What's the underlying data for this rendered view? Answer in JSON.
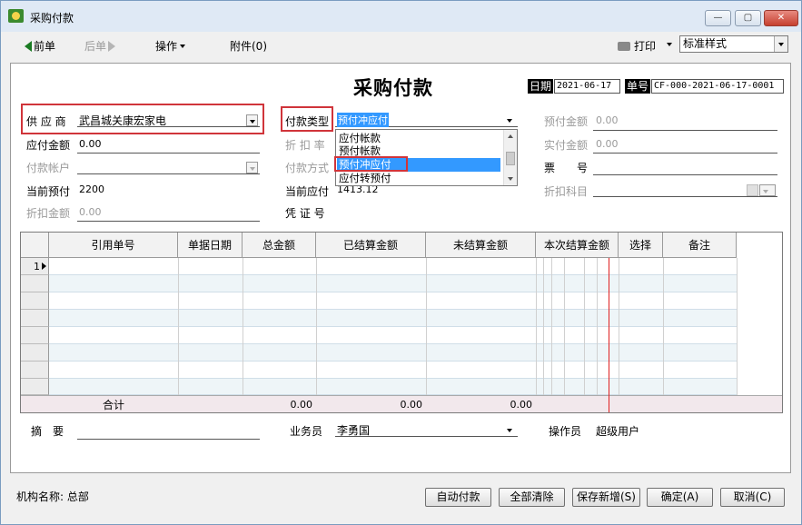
{
  "window": {
    "title": "采购付款",
    "minimize": "—",
    "maximize": "▢",
    "close": "✕"
  },
  "toolbar": {
    "prev": "前单",
    "next": "后单",
    "operate": "操作",
    "attach": "附件(0)",
    "print": "打印",
    "print_style": "标准样式"
  },
  "form": {
    "title": "采购付款",
    "date_label": "日期",
    "date_value": "2021-06-17",
    "no_label": "单号",
    "no_value": "CF-000-2021-06-17-0001",
    "supplier_label": "供 应 商",
    "supplier_value": "武昌城关康宏家电",
    "payable_label": "应付金额",
    "payable_value": "0.00",
    "account_label": "付款帐户",
    "cur_prepay_label": "当前预付",
    "cur_prepay_value": "2200",
    "discount_amount_label": "折扣金额",
    "discount_amount_value": "0.00",
    "pay_type_label": "付款类型",
    "pay_type_value": "预付冲应付",
    "discount_rate_label": "折 扣 率",
    "pay_method_label": "付款方式",
    "cur_payable_label": "当前应付",
    "cur_payable_value": "1413.12",
    "voucher_label": "凭 证 号",
    "prepay_amount_label": "预付金额",
    "prepay_amount_value": "0.00",
    "actual_pay_label": "实付金额",
    "actual_pay_value": "0.00",
    "ticket_label": "票　　号",
    "discount_subject_label": "折扣科目",
    "pay_type_options": [
      "应付帐款",
      "预付帐款",
      "预付冲应付",
      "应付转预付"
    ],
    "pay_type_selected_index": 2
  },
  "grid": {
    "columns": [
      "引用单号",
      "单据日期",
      "总金额",
      "已结算金额",
      "未结算金额",
      "本次结算金额",
      "选择",
      "备注"
    ],
    "first_row_number": "1",
    "total_label": "合计",
    "totals": {
      "total": "0.00",
      "settled": "0.00",
      "unsettled": "0.00"
    }
  },
  "footer": {
    "summary_label": "摘　要",
    "salesman_label": "业务员",
    "salesman_value": "李勇国",
    "operator_label": "操作员",
    "operator_value": "超级用户"
  },
  "status": {
    "org": "机构名称: 总部"
  },
  "buttons": {
    "auto_pay": "自动付款",
    "clear_all": "全部清除",
    "save_new": "保存新增(S)",
    "ok": "确定(A)",
    "cancel": "取消(C)"
  }
}
